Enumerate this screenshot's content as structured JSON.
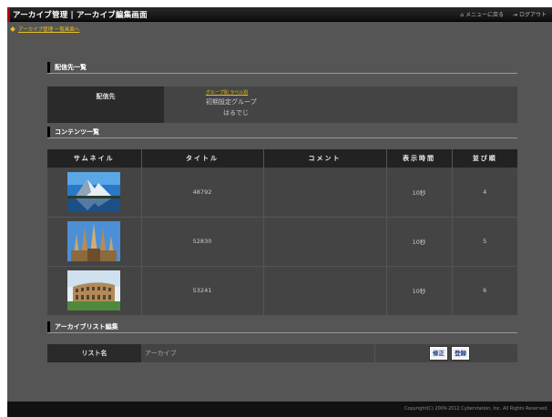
{
  "header": {
    "title": "アーカイブ管理 | アーカイブ編集画面",
    "menu_link": "メニューに戻る",
    "logout_link": "ログアウト"
  },
  "breadcrumb": "アーカイブ管理 一覧画面へ",
  "destinations": {
    "heading": "配信先一覧",
    "label": "配信先",
    "links": "グループ別  ラベル別",
    "group1": "初期設定グループ",
    "group2": "はるでじ"
  },
  "contents": {
    "heading": "コンテンツ一覧",
    "columns": [
      "サムネイル",
      "タイトル",
      "コメント",
      "表示時間",
      "並び順"
    ],
    "rows": [
      {
        "thumbnail": "mountain-lake",
        "title": "48792",
        "comment": "",
        "duration": "10秒",
        "order": "4"
      },
      {
        "thumbnail": "cathedral",
        "title": "52830",
        "comment": "",
        "duration": "10秒",
        "order": "5"
      },
      {
        "thumbnail": "colosseum",
        "title": "53241",
        "comment": "",
        "duration": "10秒",
        "order": "6"
      }
    ]
  },
  "list_edit": {
    "heading": "アーカイブリスト編集",
    "label": "リスト名",
    "value": "アーカイブ",
    "edit_button": "修正",
    "register_button": "登録"
  },
  "footer": "Copyright(C) 2009-2012 Cyberstation, Inc. All Rights Reserved.",
  "colors": {
    "background": "#555555",
    "header": "#111111",
    "accent_red": "#b0001a",
    "link_yellow": "#e8c020"
  }
}
